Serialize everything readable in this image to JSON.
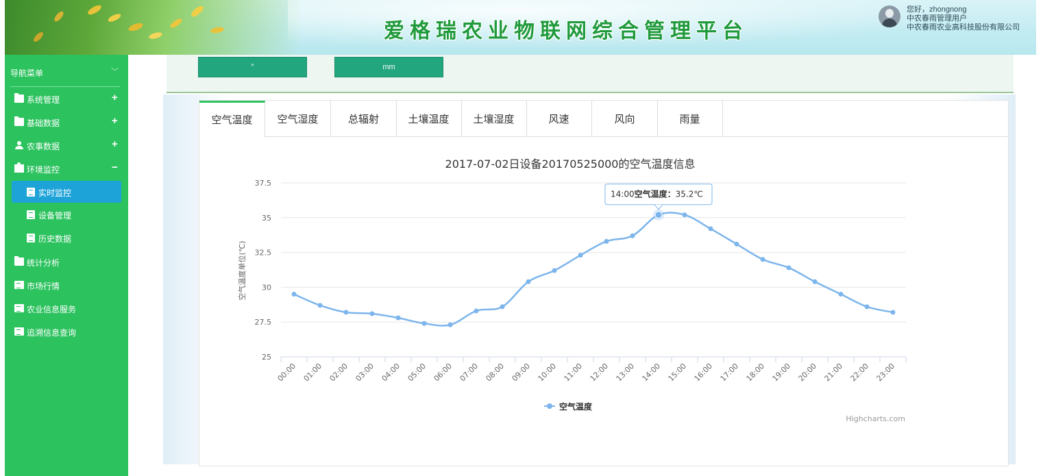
{
  "header": {
    "title": "爱格瑞农业物联网综合管理平台",
    "user_greeting": "您好，zhongnong",
    "user_role": "中农春雨管理用户",
    "user_company": "中农春雨农业高科技股份有限公司"
  },
  "sidebar": {
    "nav_title": "导航菜单",
    "items": [
      {
        "label": "系统管理",
        "icon": "folder-icon",
        "toggle": "+"
      },
      {
        "label": "基础数据",
        "icon": "folder-icon",
        "toggle": "+"
      },
      {
        "label": "农事数据",
        "icon": "user-icon",
        "toggle": "+"
      },
      {
        "label": "环境监控",
        "icon": "puzzle-icon",
        "toggle": "−"
      },
      {
        "label": "统计分析",
        "icon": "folder-icon"
      },
      {
        "label": "市场行情",
        "icon": "document-icon"
      },
      {
        "label": "农业信息服务",
        "icon": "document-icon"
      },
      {
        "label": "追溯信息查询",
        "icon": "document-icon"
      }
    ],
    "sub_items": [
      {
        "label": "实时监控",
        "active": true
      },
      {
        "label": "设备管理",
        "active": false
      },
      {
        "label": "历史数据",
        "active": false
      }
    ],
    "color": "#2cc25e",
    "active_color": "#1ea3d9"
  },
  "sensors": {
    "box1": "°",
    "box2": "mm"
  },
  "tabs": [
    "空气温度",
    "空气湿度",
    "总辐射",
    "土壤温度",
    "土壤湿度",
    "风速",
    "风向",
    "雨量"
  ],
  "active_tab": 0,
  "chart_data": {
    "type": "line",
    "title": "2017-07-02日设备20170525000的空气温度信息",
    "ylabel": "空气温度单位(℃)",
    "xlabel": "",
    "categories": [
      "00:00",
      "01:00",
      "02:00",
      "03:00",
      "04:00",
      "05:00",
      "06:00",
      "07:00",
      "08:00",
      "09:00",
      "10:00",
      "11:00",
      "12:00",
      "13:00",
      "14:00",
      "15:00",
      "16:00",
      "17:00",
      "18:00",
      "19:00",
      "20:00",
      "21:00",
      "22:00",
      "23:00"
    ],
    "series": [
      {
        "name": "空气温度",
        "values": [
          29.5,
          28.7,
          28.2,
          28.1,
          27.8,
          27.4,
          27.3,
          28.3,
          28.6,
          30.4,
          31.2,
          32.3,
          33.3,
          33.7,
          35.2,
          35.2,
          34.2,
          33.1,
          32.0,
          31.4,
          30.4,
          29.5,
          28.6,
          28.2
        ],
        "color": "#7cb5ec"
      }
    ],
    "ylim": [
      25,
      37.5
    ],
    "yticks": [
      "25",
      "27.5",
      "30",
      "32.5",
      "35",
      "37.5"
    ],
    "grid": true,
    "legend": "bottom-center",
    "tooltip": {
      "index": 14,
      "time": "14:00",
      "label": "空气温度",
      "value": "35.2℃"
    },
    "credits": "Highcharts.com"
  }
}
